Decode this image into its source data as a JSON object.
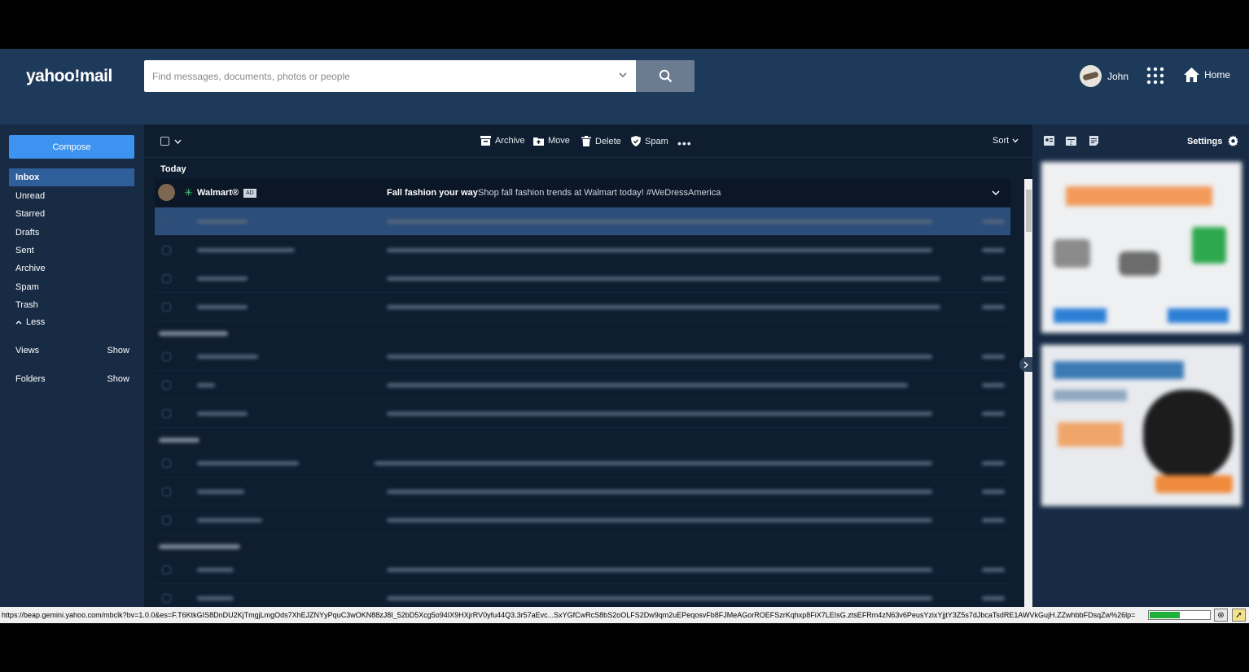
{
  "header": {
    "logo": "yahoo!mail",
    "search_placeholder": "Find messages, documents, photos or people",
    "user_name": "John",
    "home_label": "Home"
  },
  "sidebar": {
    "compose": "Compose",
    "folders": [
      "Inbox",
      "Unread",
      "Starred",
      "Drafts",
      "Sent",
      "Archive",
      "Spam",
      "Trash"
    ],
    "less": "Less",
    "views_label": "Views",
    "views_action": "Show",
    "folders_label": "Folders",
    "folders_action": "Show"
  },
  "toolbar": {
    "archive": "Archive",
    "move": "Move",
    "delete": "Delete",
    "spam": "Spam",
    "sort": "Sort"
  },
  "messages": {
    "section_today": "Today",
    "ad": {
      "sender": "Walmart®",
      "badge": "AD",
      "subject": "Fall fashion your way",
      "snippet": "Shop fall fashion trends at Walmart today! #WeDressAmerica"
    }
  },
  "right_panel": {
    "settings": "Settings"
  },
  "status_bar": {
    "url": "https://beap.gemini.yahoo.com/mbclk?bv=1.0.0&es=F.T6KtkGIS8DnDU2KjTmgjLmgOds7XhEJZNYyPquC3wOKN88zJ8I_52bD5Xcg5o94IX9HXjrRV0yfu44Q3.3r57aEvc...SxYGfCwRcS8bS2oOLFS2Dw9qm2uEPeqosvFb8FJMeAGorROEFSzrKqhxp8FiX7LEIsG.ztsEFRm4zN63v6PeusYzixYjjtY3Z5s7dJbcaTsdRE1AWVkGujH.ZZwhbbFDsqZw%26lp=",
    "progress": 0.5
  },
  "colors": {
    "header_bg": "#1e3a5a",
    "sidebar_bg": "#182b45",
    "main_bg": "#0f1d30",
    "compose_blue": "#3c93f0",
    "active_item": "#2e5f9b",
    "selected_row": "#2c4e7a"
  },
  "icons": [
    "search-icon",
    "chevron-down-icon",
    "apps-grid-icon",
    "home-icon",
    "archive-icon",
    "move-icon",
    "trash-icon",
    "shield-icon",
    "more-icon",
    "settings-gear-icon"
  ]
}
